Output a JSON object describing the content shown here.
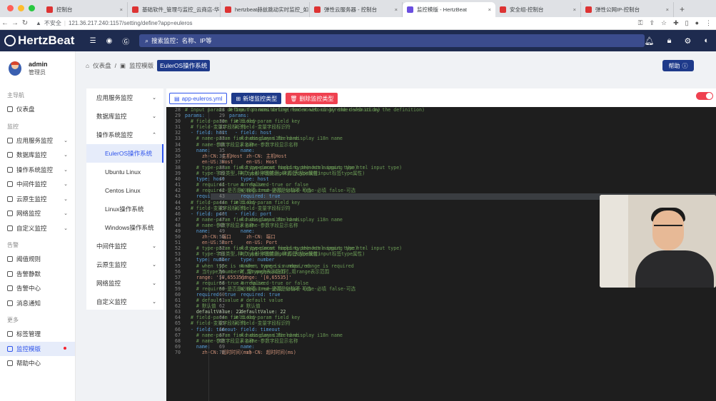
{
  "browser": {
    "tabs": [
      {
        "label": "控制台",
        "active": false
      },
      {
        "label": "基础软件_管理与监控_云商店-华",
        "active": false
      },
      {
        "label": "hertzbeat赫兹跳动实时监控_如",
        "active": false
      },
      {
        "label": "弹性云服务器 - 控制台",
        "active": false
      },
      {
        "label": "监控模版 - HertzBeat",
        "active": true
      },
      {
        "label": "安全组-控制台",
        "active": false
      },
      {
        "label": "弹性公网IP-控制台",
        "active": false
      }
    ],
    "security_label": "不安全",
    "url": "121.36.217.240:1157/setting/define?app=euleros"
  },
  "topnav": {
    "brand": "HertzBeat",
    "search_placeholder": "搜索监控：名称、IP等"
  },
  "user": {
    "name": "admin",
    "role": "管理员"
  },
  "sidebar": {
    "groups": [
      {
        "title": "主导航",
        "items": [
          {
            "label": "仪表盘",
            "arrow": false
          }
        ]
      },
      {
        "title": "监控",
        "items": [
          {
            "label": "应用服务监控",
            "arrow": true
          },
          {
            "label": "数据库监控",
            "arrow": true
          },
          {
            "label": "操作系统监控",
            "arrow": true
          },
          {
            "label": "中间件监控",
            "arrow": true
          },
          {
            "label": "云原生监控",
            "arrow": true
          },
          {
            "label": "网络监控",
            "arrow": true
          },
          {
            "label": "自定义监控",
            "arrow": true
          }
        ]
      },
      {
        "title": "告警",
        "items": [
          {
            "label": "阈值规则",
            "arrow": false
          },
          {
            "label": "告警静默",
            "arrow": false
          },
          {
            "label": "告警中心",
            "arrow": false
          },
          {
            "label": "消息通知",
            "arrow": false
          }
        ]
      },
      {
        "title": "更多",
        "items": [
          {
            "label": "标签管理",
            "arrow": false
          },
          {
            "label": "监控模版",
            "arrow": false,
            "active": true
          },
          {
            "label": "帮助中心",
            "arrow": false
          }
        ]
      }
    ]
  },
  "breadcrumb": {
    "home": "仪表盘",
    "parent": "监控模版",
    "current": "EulerOS操作系统"
  },
  "help_button": "帮助",
  "submenu": [
    {
      "label": "应用服务监控",
      "arrow": "down",
      "sub": false
    },
    {
      "label": "数据库监控",
      "arrow": "down",
      "sub": false
    },
    {
      "label": "操作系统监控",
      "arrow": "up",
      "sub": false
    },
    {
      "label": "EulerOS操作系统",
      "arrow": "",
      "sub": true,
      "selected": true
    },
    {
      "label": "Ubuntu Linux",
      "arrow": "",
      "sub": true
    },
    {
      "label": "Centos Linux",
      "arrow": "",
      "sub": true
    },
    {
      "label": "Linux操作系统",
      "arrow": "",
      "sub": true
    },
    {
      "label": "Windows操作系统",
      "arrow": "",
      "sub": true
    },
    {
      "label": "中间件监控",
      "arrow": "down",
      "sub": false
    },
    {
      "label": "云原生监控",
      "arrow": "down",
      "sub": false
    },
    {
      "label": "网络监控",
      "arrow": "down",
      "sub": false
    },
    {
      "label": "自定义监控",
      "arrow": "down",
      "sub": false
    }
  ],
  "editor": {
    "file_button": "app-euleros.yml",
    "add_button": "新增监控类型",
    "delete_button": "删除监控类型",
    "lines": [
      {
        "n": 28,
        "t": "# Input params define for monitoring(render web ui by the definition)",
        "c": "c"
      },
      {
        "n": 29,
        "t": "params:",
        "c": "k"
      },
      {
        "n": 30,
        "t": "  # field-param field key",
        "c": "c"
      },
      {
        "n": 31,
        "t": "  # field-变量字段标识符",
        "c": "c"
      },
      {
        "n": 32,
        "t": "  - field: host",
        "c": "k"
      },
      {
        "n": 33,
        "t": "    # name-param field display i18n name",
        "c": "c"
      },
      {
        "n": 34,
        "t": "    # name-参数字段显示名称",
        "c": "c"
      },
      {
        "n": 35,
        "t": "    name:",
        "c": "k"
      },
      {
        "n": 36,
        "t": "      zh-CN: 主机Host",
        "c": "s"
      },
      {
        "n": 37,
        "t": "      en-US: Host",
        "c": "s"
      },
      {
        "n": 38,
        "t": "    # type-param field type(most mapping the html input type)",
        "c": "c"
      },
      {
        "n": 39,
        "t": "    # type-字段类型,样式(大部分映射input标签type属性)",
        "c": "c"
      },
      {
        "n": 40,
        "t": "    type: host",
        "c": "k"
      },
      {
        "n": 41,
        "t": "    # required-true or false",
        "c": "c"
      },
      {
        "n": 42,
        "t": "    # required-是否是必输项 true-必填 false-可选",
        "c": "c"
      },
      {
        "n": 43,
        "t": "    required: true",
        "c": "k",
        "hl": true
      },
      {
        "n": 44,
        "t": "  # field-param field key",
        "c": "c"
      },
      {
        "n": 45,
        "t": "  # field-变量字段标识符",
        "c": "c"
      },
      {
        "n": 46,
        "t": "  - field: port",
        "c": "k"
      },
      {
        "n": 47,
        "t": "    # name-param field display i18n name",
        "c": "c"
      },
      {
        "n": 48,
        "t": "    # name-参数字段显示名称",
        "c": "c"
      },
      {
        "n": 49,
        "t": "    name:",
        "c": "k"
      },
      {
        "n": 50,
        "t": "      zh-CN: 端口",
        "c": "s"
      },
      {
        "n": 51,
        "t": "      en-US: Port",
        "c": "s"
      },
      {
        "n": 52,
        "t": "    # type-param field type(most mapping the html input type)",
        "c": "c"
      },
      {
        "n": 53,
        "t": "    # type-字段类型,样式(大部分映射input标签type属性)",
        "c": "c"
      },
      {
        "n": 54,
        "t": "    type: number",
        "c": "k"
      },
      {
        "n": 55,
        "t": "    # when type is number, range is required",
        "c": "c"
      },
      {
        "n": 56,
        "t": "    # 当type为number时,用range表示范围",
        "c": "c"
      },
      {
        "n": 57,
        "t": "    range: '[0,65535]'",
        "c": "s"
      },
      {
        "n": 58,
        "t": "    # required-true or false",
        "c": "c"
      },
      {
        "n": 59,
        "t": "    # required-是否是必输项 true-必填 false-可选",
        "c": "c"
      },
      {
        "n": 60,
        "t": "    required: true",
        "c": "k"
      },
      {
        "n": 61,
        "t": "    # default value",
        "c": "c"
      },
      {
        "n": 62,
        "t": "    # 默认值",
        "c": "c"
      },
      {
        "n": 63,
        "t": "    defaultValue: 22",
        "c": "n"
      },
      {
        "n": 64,
        "t": "  # field-param field key",
        "c": "c"
      },
      {
        "n": 65,
        "t": "  # field-变量字段标识符",
        "c": "c"
      },
      {
        "n": 66,
        "t": "  - field: timeout",
        "c": "k"
      },
      {
        "n": 67,
        "t": "    # name-param field display i18n name",
        "c": "c"
      },
      {
        "n": 68,
        "t": "    # name-参数字段显示名称",
        "c": "c"
      },
      {
        "n": 69,
        "t": "    name:",
        "c": "k"
      },
      {
        "n": 70,
        "t": "      zh-CN: 超时时间(ms)",
        "c": "s"
      }
    ]
  }
}
